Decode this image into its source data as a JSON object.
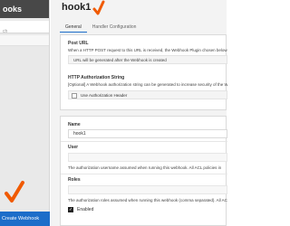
{
  "sidebar": {
    "header_title": "ooks",
    "search_placeholder": "ch",
    "create_button": "Create Webhook"
  },
  "main": {
    "title": "hook1",
    "tabs": [
      {
        "label": "General"
      },
      {
        "label": "Handler Configuration"
      }
    ],
    "post_url": {
      "label": "Post URL",
      "description": "When a HTTP POST request to this URL is received, the Webhook Plugin chosen below will be executed.",
      "value": "URL will be generated after the Webhook is created"
    },
    "http_auth": {
      "label": "HTTP Authorization String",
      "description": "[Optional] A Webhook authorization string can be generated to increase security of the Webhook.",
      "use_header_label": "Use Authorization Header"
    },
    "name": {
      "label": "Name",
      "value": "hook1"
    },
    "user": {
      "label": "User",
      "description": "The authorization username assumed when running this webhook. All ACL policies in"
    },
    "roles": {
      "label": "Roles",
      "description": "The authorization roles assumed when running this webhook (comma separated). All ACL"
    },
    "enabled": {
      "label": "Enabled",
      "checked": true
    }
  },
  "colors": {
    "accent": "#1c6dc9",
    "annotation": "#f05a00",
    "sidebar_header": "#484848"
  }
}
